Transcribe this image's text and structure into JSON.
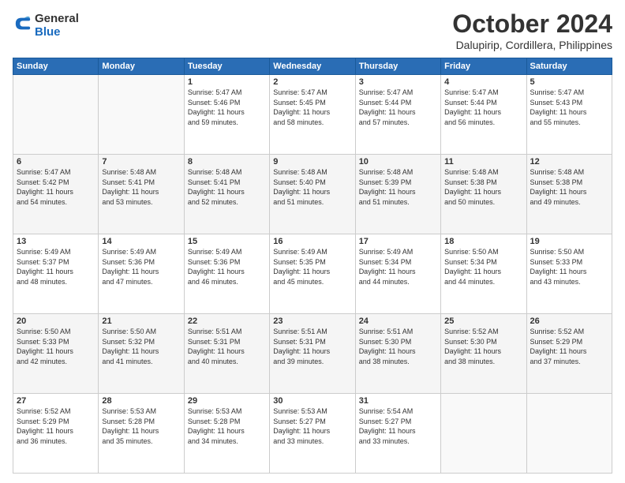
{
  "logo": {
    "line1": "General",
    "line2": "Blue"
  },
  "title": "October 2024",
  "subtitle": "Dalupirip, Cordillera, Philippines",
  "weekdays": [
    "Sunday",
    "Monday",
    "Tuesday",
    "Wednesday",
    "Thursday",
    "Friday",
    "Saturday"
  ],
  "rows": [
    [
      {
        "day": "",
        "info": ""
      },
      {
        "day": "",
        "info": ""
      },
      {
        "day": "1",
        "info": "Sunrise: 5:47 AM\nSunset: 5:46 PM\nDaylight: 11 hours\nand 59 minutes."
      },
      {
        "day": "2",
        "info": "Sunrise: 5:47 AM\nSunset: 5:45 PM\nDaylight: 11 hours\nand 58 minutes."
      },
      {
        "day": "3",
        "info": "Sunrise: 5:47 AM\nSunset: 5:44 PM\nDaylight: 11 hours\nand 57 minutes."
      },
      {
        "day": "4",
        "info": "Sunrise: 5:47 AM\nSunset: 5:44 PM\nDaylight: 11 hours\nand 56 minutes."
      },
      {
        "day": "5",
        "info": "Sunrise: 5:47 AM\nSunset: 5:43 PM\nDaylight: 11 hours\nand 55 minutes."
      }
    ],
    [
      {
        "day": "6",
        "info": "Sunrise: 5:47 AM\nSunset: 5:42 PM\nDaylight: 11 hours\nand 54 minutes."
      },
      {
        "day": "7",
        "info": "Sunrise: 5:48 AM\nSunset: 5:41 PM\nDaylight: 11 hours\nand 53 minutes."
      },
      {
        "day": "8",
        "info": "Sunrise: 5:48 AM\nSunset: 5:41 PM\nDaylight: 11 hours\nand 52 minutes."
      },
      {
        "day": "9",
        "info": "Sunrise: 5:48 AM\nSunset: 5:40 PM\nDaylight: 11 hours\nand 51 minutes."
      },
      {
        "day": "10",
        "info": "Sunrise: 5:48 AM\nSunset: 5:39 PM\nDaylight: 11 hours\nand 51 minutes."
      },
      {
        "day": "11",
        "info": "Sunrise: 5:48 AM\nSunset: 5:38 PM\nDaylight: 11 hours\nand 50 minutes."
      },
      {
        "day": "12",
        "info": "Sunrise: 5:48 AM\nSunset: 5:38 PM\nDaylight: 11 hours\nand 49 minutes."
      }
    ],
    [
      {
        "day": "13",
        "info": "Sunrise: 5:49 AM\nSunset: 5:37 PM\nDaylight: 11 hours\nand 48 minutes."
      },
      {
        "day": "14",
        "info": "Sunrise: 5:49 AM\nSunset: 5:36 PM\nDaylight: 11 hours\nand 47 minutes."
      },
      {
        "day": "15",
        "info": "Sunrise: 5:49 AM\nSunset: 5:36 PM\nDaylight: 11 hours\nand 46 minutes."
      },
      {
        "day": "16",
        "info": "Sunrise: 5:49 AM\nSunset: 5:35 PM\nDaylight: 11 hours\nand 45 minutes."
      },
      {
        "day": "17",
        "info": "Sunrise: 5:49 AM\nSunset: 5:34 PM\nDaylight: 11 hours\nand 44 minutes."
      },
      {
        "day": "18",
        "info": "Sunrise: 5:50 AM\nSunset: 5:34 PM\nDaylight: 11 hours\nand 44 minutes."
      },
      {
        "day": "19",
        "info": "Sunrise: 5:50 AM\nSunset: 5:33 PM\nDaylight: 11 hours\nand 43 minutes."
      }
    ],
    [
      {
        "day": "20",
        "info": "Sunrise: 5:50 AM\nSunset: 5:33 PM\nDaylight: 11 hours\nand 42 minutes."
      },
      {
        "day": "21",
        "info": "Sunrise: 5:50 AM\nSunset: 5:32 PM\nDaylight: 11 hours\nand 41 minutes."
      },
      {
        "day": "22",
        "info": "Sunrise: 5:51 AM\nSunset: 5:31 PM\nDaylight: 11 hours\nand 40 minutes."
      },
      {
        "day": "23",
        "info": "Sunrise: 5:51 AM\nSunset: 5:31 PM\nDaylight: 11 hours\nand 39 minutes."
      },
      {
        "day": "24",
        "info": "Sunrise: 5:51 AM\nSunset: 5:30 PM\nDaylight: 11 hours\nand 38 minutes."
      },
      {
        "day": "25",
        "info": "Sunrise: 5:52 AM\nSunset: 5:30 PM\nDaylight: 11 hours\nand 38 minutes."
      },
      {
        "day": "26",
        "info": "Sunrise: 5:52 AM\nSunset: 5:29 PM\nDaylight: 11 hours\nand 37 minutes."
      }
    ],
    [
      {
        "day": "27",
        "info": "Sunrise: 5:52 AM\nSunset: 5:29 PM\nDaylight: 11 hours\nand 36 minutes."
      },
      {
        "day": "28",
        "info": "Sunrise: 5:53 AM\nSunset: 5:28 PM\nDaylight: 11 hours\nand 35 minutes."
      },
      {
        "day": "29",
        "info": "Sunrise: 5:53 AM\nSunset: 5:28 PM\nDaylight: 11 hours\nand 34 minutes."
      },
      {
        "day": "30",
        "info": "Sunrise: 5:53 AM\nSunset: 5:27 PM\nDaylight: 11 hours\nand 33 minutes."
      },
      {
        "day": "31",
        "info": "Sunrise: 5:54 AM\nSunset: 5:27 PM\nDaylight: 11 hours\nand 33 minutes."
      },
      {
        "day": "",
        "info": ""
      },
      {
        "day": "",
        "info": ""
      }
    ]
  ]
}
